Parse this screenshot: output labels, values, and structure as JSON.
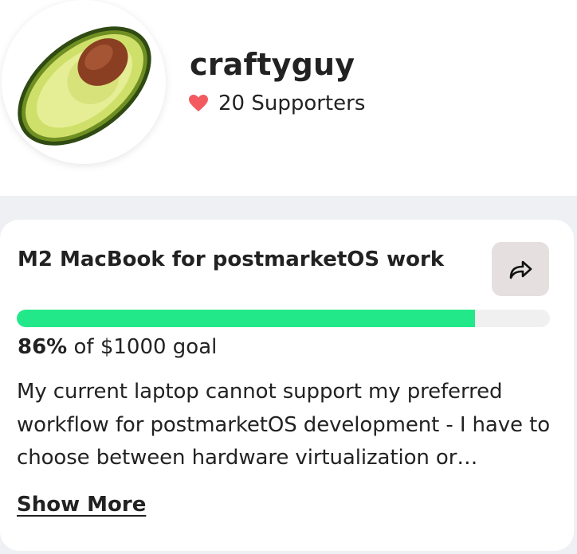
{
  "profile": {
    "username": "craftyguy",
    "supporters_label": "20 Supporters",
    "avatar_image": "avocado-half",
    "heart_color": "#f25a5f"
  },
  "campaign": {
    "title": "M2 MacBook for postmarketOS work",
    "share_icon": "share-arrow-icon",
    "progress_percent": 86,
    "progress_color": "#23e88a",
    "percent_label": "86%",
    "goal_rest": " of $1000 goal",
    "description": "My current laptop cannot support my preferred workflow for postmarketOS development - I have to choose between hardware virtualization or adequate memory to build and test images, and I can't have both.",
    "show_more_label": "Show More"
  }
}
